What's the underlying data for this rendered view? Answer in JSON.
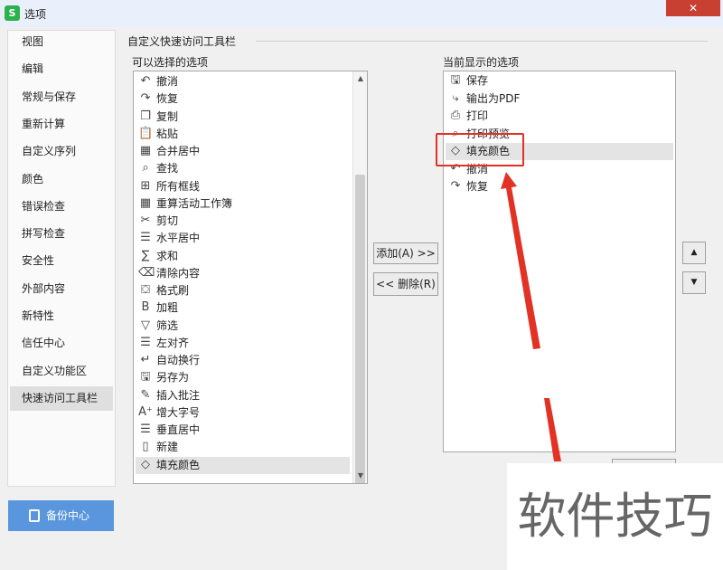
{
  "window": {
    "title": "选项",
    "app_icon_letter": "S",
    "close_glyph": "✕"
  },
  "nav": {
    "items": [
      "视图",
      "编辑",
      "常规与保存",
      "重新计算",
      "自定义序列",
      "颜色",
      "错误检查",
      "拼写检查",
      "安全性",
      "外部内容",
      "新特性",
      "信任中心",
      "自定义功能区",
      "快速访问工具栏"
    ],
    "active": "快速访问工具栏"
  },
  "backup_button": "备份中心",
  "group_title": "自定义快速访问工具栏",
  "available": {
    "label": "可以选择的选项",
    "items": [
      {
        "label": "撤消",
        "icon": "undo-icon",
        "glyph": "↶"
      },
      {
        "label": "恢复",
        "icon": "redo-icon",
        "glyph": "↷"
      },
      {
        "label": "复制",
        "icon": "copy-icon",
        "glyph": "❐"
      },
      {
        "label": "粘贴",
        "icon": "paste-icon",
        "glyph": "📋"
      },
      {
        "label": "合并居中",
        "icon": "merge-center-icon",
        "glyph": "▦"
      },
      {
        "label": "查找",
        "icon": "find-icon",
        "glyph": "⌕"
      },
      {
        "label": "所有框线",
        "icon": "all-borders-icon",
        "glyph": "⊞"
      },
      {
        "label": "重算活动工作簿",
        "icon": "recalc-icon",
        "glyph": "▦"
      },
      {
        "label": "剪切",
        "icon": "cut-icon",
        "glyph": "✂"
      },
      {
        "label": "水平居中",
        "icon": "align-center-icon",
        "glyph": "☰"
      },
      {
        "label": "求和",
        "icon": "sum-icon",
        "glyph": "∑"
      },
      {
        "label": "清除内容",
        "icon": "clear-icon",
        "glyph": "⌫"
      },
      {
        "label": "格式刷",
        "icon": "format-painter-icon",
        "glyph": "⛋"
      },
      {
        "label": "加粗",
        "icon": "bold-icon",
        "glyph": "B"
      },
      {
        "label": "筛选",
        "icon": "filter-icon",
        "glyph": "▽"
      },
      {
        "label": "左对齐",
        "icon": "align-left-icon",
        "glyph": "☰"
      },
      {
        "label": "自动换行",
        "icon": "wrap-text-icon",
        "glyph": "↵"
      },
      {
        "label": "另存为",
        "icon": "save-as-icon",
        "glyph": "🖫"
      },
      {
        "label": "插入批注",
        "icon": "comment-icon",
        "glyph": "✎"
      },
      {
        "label": "增大字号",
        "icon": "font-grow-icon",
        "glyph": "A⁺"
      },
      {
        "label": "垂直居中",
        "icon": "valign-center-icon",
        "glyph": "☰"
      },
      {
        "label": "新建",
        "icon": "new-doc-icon",
        "glyph": "▯"
      },
      {
        "label": "填充颜色",
        "icon": "fill-color-icon",
        "glyph": "◇"
      }
    ],
    "selected": "填充颜色"
  },
  "current": {
    "label": "当前显示的选项",
    "items": [
      {
        "label": "保存",
        "icon": "save-icon",
        "glyph": "🖫"
      },
      {
        "label": "输出为PDF",
        "icon": "export-pdf-icon",
        "glyph": "⤷"
      },
      {
        "label": "打印",
        "icon": "print-icon",
        "glyph": "⎙"
      },
      {
        "label": "打印预览",
        "icon": "print-preview-icon",
        "glyph": "⌕"
      },
      {
        "label": "填充颜色",
        "icon": "fill-color-icon",
        "glyph": "◇"
      },
      {
        "label": "撤消",
        "icon": "undo-icon",
        "glyph": "↶"
      },
      {
        "label": "恢复",
        "icon": "redo-icon",
        "glyph": "↷"
      }
    ],
    "selected": "填充颜色"
  },
  "buttons": {
    "add": "添加(A) >>",
    "remove": "<< 删除(R)",
    "move_up": "▲",
    "move_down": "▼"
  },
  "watermark": "软件技巧",
  "colors": {
    "accent": "#5a96de",
    "highlight": "#e23226",
    "close": "#c84031"
  }
}
